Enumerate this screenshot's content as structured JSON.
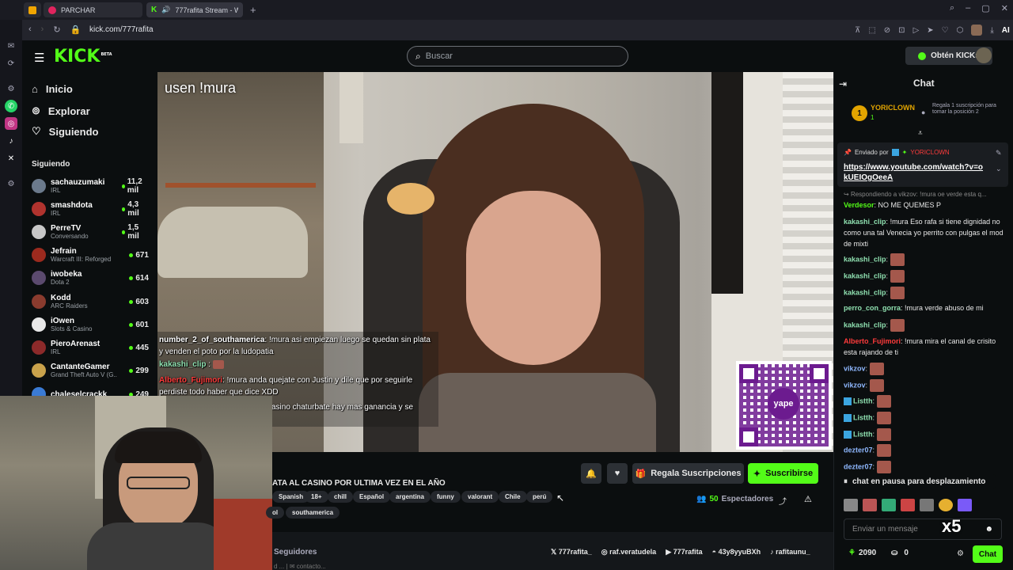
{
  "browser": {
    "tabs": [
      {
        "label": "PARCHAR"
      },
      {
        "label": "777rafita Stream - Wat"
      }
    ],
    "new_tab": "+",
    "url": "kick.com/777rafita",
    "ai_label": "AI"
  },
  "header": {
    "logo": "KICK",
    "beta": "BETA",
    "search_placeholder": "Buscar",
    "kicks_button": "Obtén KICKs"
  },
  "nav": {
    "items": [
      {
        "label": "Inicio",
        "icon": "home-icon"
      },
      {
        "label": "Explorar",
        "icon": "compass-icon"
      },
      {
        "label": "Siguiendo",
        "icon": "heart-icon"
      }
    ],
    "following_title": "Siguiendo",
    "following": [
      {
        "name": "sachauzumaki",
        "sub": "IRL",
        "viewers": "11,2 mil",
        "color": "#6b7a8c"
      },
      {
        "name": "smashdota",
        "sub": "IRL",
        "viewers": "4,3 mil",
        "color": "#b0332e"
      },
      {
        "name": "PerreTV",
        "sub": "Conversando",
        "viewers": "1,5 mil",
        "color": "#c7c7c7"
      },
      {
        "name": "Jefrain",
        "sub": "Warcraft III: Reforged",
        "viewers": "671",
        "color": "#9b2a1e"
      },
      {
        "name": "iwobeka",
        "sub": "Dota 2",
        "viewers": "614",
        "color": "#5b4a6e"
      },
      {
        "name": "Kodd",
        "sub": "ARC Raiders",
        "viewers": "603",
        "color": "#8a3b2e"
      },
      {
        "name": "iOwen",
        "sub": "Slots & Casino",
        "viewers": "601",
        "color": "#e8e8e8"
      },
      {
        "name": "PieroArenast",
        "sub": "IRL",
        "viewers": "445",
        "color": "#8c2a2a"
      },
      {
        "name": "CantanteGamer",
        "sub": "Grand Theft Auto V (G...",
        "viewers": "299",
        "color": "#c9a24b"
      },
      {
        "name": "chaleselcrackk",
        "sub": "",
        "viewers": "249",
        "color": "#3a7bd5"
      }
    ]
  },
  "video": {
    "overlay_top": "usen !mura",
    "overlay_chat": [
      {
        "user": "number_2_of_southamerica",
        "user_color": "#ffffff",
        "text": ": !mura asi empiezan luego se quedan sin plata y venden el poto por la ludopatia"
      },
      {
        "user": "kakashi_clip",
        "user_color": "#8fe0b0",
        "text": ":"
      },
      {
        "user": "Alberto_Fujimori",
        "user_color": "#ff3b3b",
        "text": ": !mura anda quejate con Justin y dile que por seguirle perdiste todo haber que dice XDD"
      },
      {
        "user": "",
        "user_color": "#ffffff",
        "text": "asino chaturbate hay mas ganancia y se"
      }
    ],
    "qr_label": "yape"
  },
  "stream": {
    "title": "ATA AL CASINO POR ULTIMA VEZ EN EL AÑO",
    "tags": [
      "Spanish",
      "18+",
      "chill",
      "Español",
      "argentina",
      "funny",
      "valorant",
      "Chile",
      "perú",
      "ol",
      "southamerica"
    ],
    "gift_button": "Regala Suscripciones",
    "subscribe_button": "Suscribirse",
    "viewers_count": "50",
    "viewers_label": "Espectadores",
    "followers_label": "Seguidores",
    "socials": [
      "777rafita_",
      "raf.veratudela",
      "777rafita",
      "43y8yyuBXh",
      "rafitaunu_"
    ],
    "below_text": "d ... | ✉ contacto..."
  },
  "chat": {
    "title": "Chat",
    "pinned_user": "YORICLOWN",
    "pinned_count": "1",
    "gift_note": "Regala 1 suscripción para tomar la posición 2",
    "sent_by_label": "Enviado por",
    "sent_by_user": "YORICLOWN",
    "pinned_link": "https://www.youtube.com/watch?v=okUEIOgOeeA",
    "reply_note": "Respondiendo a vikzov: !mura oe verde esta q...",
    "messages": [
      {
        "user": "Verdesor",
        "color": "#53fc18",
        "text": "NO ME QUEMES P",
        "emote": false
      },
      {
        "user": "kakashi_clip",
        "color": "#8fe0b0",
        "text": "!mura Eso rafa si tiene dignidad no como una tal Venecia yo perrito con pulgas el mod de mixti",
        "emote": false
      },
      {
        "user": "kakashi_clip",
        "color": "#8fe0b0",
        "text": "",
        "emote": true
      },
      {
        "user": "kakashi_clip",
        "color": "#8fe0b0",
        "text": "",
        "emote": true
      },
      {
        "user": "kakashi_clip",
        "color": "#8fe0b0",
        "text": "",
        "emote": true
      },
      {
        "user": "perro_con_gorra",
        "color": "#8fe0b0",
        "text": "!mura verde abuso de mi",
        "emote": false
      },
      {
        "user": "kakashi_clip",
        "color": "#8fe0b0",
        "text": "",
        "emote": true
      },
      {
        "user": "Alberto_Fujimori",
        "color": "#ff3b3b",
        "text": "!mura mira el canal de crisito esta rajando de ti",
        "emote": false
      },
      {
        "user": "vikzov",
        "color": "#8fb8ff",
        "text": "",
        "emote": true
      },
      {
        "user": "vikzov",
        "color": "#8fb8ff",
        "text": "",
        "emote": true
      },
      {
        "user": "Listth",
        "color": "#8fe0b0",
        "text": "",
        "emote": true
      },
      {
        "user": "Listth",
        "color": "#8fe0b0",
        "text": "",
        "emote": true
      },
      {
        "user": "Listth",
        "color": "#8fe0b0",
        "text": "",
        "emote": true
      },
      {
        "user": "dezter07",
        "color": "#8fb8ff",
        "text": "",
        "emote": true
      },
      {
        "user": "dezter07",
        "color": "#8fb8ff",
        "text": "",
        "emote": true
      }
    ],
    "paused_label": "chat en pausa para desplazamiento",
    "input_placeholder": "Enviar un mensaje",
    "combo": "x5",
    "points": "2090",
    "chest_count": "0",
    "send_button": "Chat"
  },
  "colors": {
    "accent": "#53fc18",
    "bg": "#0b0e0f",
    "panel": "#24272c"
  }
}
